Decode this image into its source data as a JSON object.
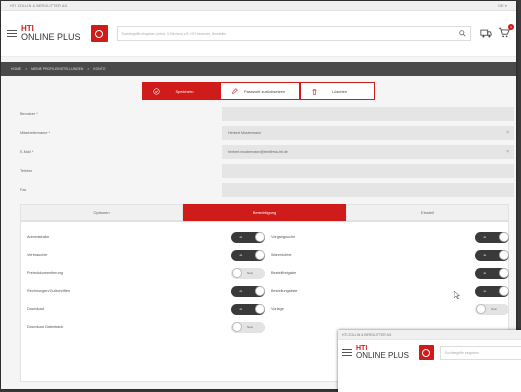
{
  "topbar": {
    "company": "HTI ZOLLIN & BERGLITTER AG",
    "menu": "DE ▾"
  },
  "header": {
    "logo_top": "HTI",
    "logo_bottom": "ONLINE PLUS",
    "search_placeholder": "Suchbegriffe eingeben (mind. 3 Zeichen) z.B. HTI-Nummer, Hersteller",
    "cart_count": "4"
  },
  "breadcrumb": [
    "HOME",
    ">",
    "MEINE PROFILEINSTELLUNGEN",
    ">",
    "KONTO"
  ],
  "actions": {
    "save": "Speichern",
    "reset_password": "Passwort zurücksetzen",
    "delete": "Löschen"
  },
  "form": [
    {
      "label": "Benutzer *",
      "value": "",
      "clearable": false
    },
    {
      "label": "Mitarbeitername *",
      "value": "Herbert Mustermann",
      "clearable": true
    },
    {
      "label": "E-Mail *",
      "value": "herbert.mustermann@testfirma-hti.de",
      "clearable": true
    },
    {
      "label": "Telefon",
      "value": "",
      "clearable": false
    },
    {
      "label": "Fax",
      "value": "",
      "clearable": false
    }
  ],
  "tabs": [
    {
      "label": "Optionen",
      "active": false
    },
    {
      "label": "Berechtigung",
      "active": true
    },
    {
      "label": "Einstell",
      "active": false
    }
  ],
  "permissions_left": [
    {
      "label": "Administrator",
      "state": "on",
      "text": "Ja"
    },
    {
      "label": "Verbraucher",
      "state": "on",
      "text": "Ja"
    },
    {
      "label": "Preisdokumentierung",
      "state": "off",
      "text": "Nein"
    },
    {
      "label": "Rechnungen/Gutschriften",
      "state": "on",
      "text": "Ja"
    },
    {
      "label": "Download",
      "state": "on",
      "text": "Ja"
    },
    {
      "label": "Download Datenbank",
      "state": "off",
      "text": "Nein"
    }
  ],
  "permissions_right": [
    {
      "label": "Vorgangsuche",
      "state": "on",
      "text": "Ja"
    },
    {
      "label": "Warenkörbe",
      "state": "on",
      "text": "Ja"
    },
    {
      "label": "Bestellfreigabe",
      "state": "on",
      "text": "Ja"
    },
    {
      "label": "Bestellungsliste",
      "state": "on",
      "text": "Ja"
    },
    {
      "label": "Vorlage",
      "state": "off",
      "text": "Nein"
    }
  ],
  "second_window": {
    "company": "HTI ZOLLIN & BERGLITTER AG",
    "logo_top": "HTI",
    "logo_bottom": "ONLINE PLUS",
    "search_placeholder": "Suchbegriffe eingeben"
  },
  "colors": {
    "brand_red": "#d01b1b",
    "toggle_on": "#3a3a3a",
    "toggle_off": "#e3e3e3"
  }
}
